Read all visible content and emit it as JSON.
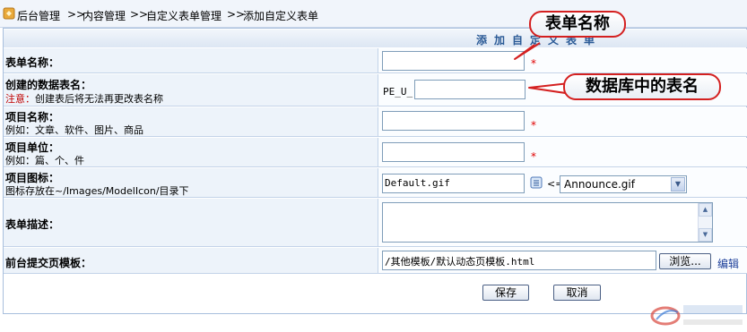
{
  "breadcrumb": {
    "items": [
      "后台管理",
      "内容管理",
      "自定义表单管理",
      "添加自定义表单"
    ],
    "separator": ">>"
  },
  "form": {
    "title": "添加自定义表单",
    "fields": {
      "name": {
        "label": "表单名称：",
        "value": ""
      },
      "table": {
        "label": "创建的数据表名：",
        "note_prefix": "注意：",
        "note": "创建表后将无法再更改表名称",
        "prefix": "PE_U_",
        "value": ""
      },
      "item_name": {
        "label": "项目名称：",
        "hint": "例如：文章、软件、图片、商品",
        "value": ""
      },
      "item_unit": {
        "label": "项目单位：",
        "hint": "例如：篇、个、件",
        "value": ""
      },
      "item_icon": {
        "label": "项目图标：",
        "hint": "图标存放在~/Images/ModelIcon/目录下",
        "value": "Default.gif",
        "arrow": "<=",
        "selected": "Announce.gif"
      },
      "description": {
        "label": "表单描述：",
        "value": ""
      },
      "template": {
        "label": "前台提交页模板：",
        "value": "/其他模板/默认动态页模板.html",
        "browse": "浏览...",
        "edit": "编辑"
      }
    },
    "required_mark": "*",
    "save_label": "保存",
    "cancel_label": "取消"
  },
  "callouts": {
    "form_name": "表单名称",
    "table_name": "数据库中的表名"
  },
  "colors": {
    "accent": "#2a5a96",
    "label_bg": "#edf3fa",
    "required": "#e00000",
    "callout_border": "#d42020"
  }
}
